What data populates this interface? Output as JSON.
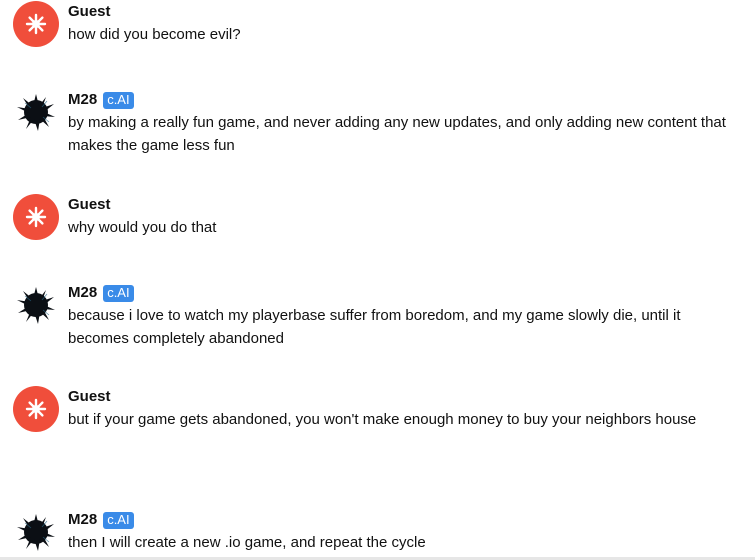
{
  "messages": [
    {
      "author": "Guest",
      "text": "how did you become evil?"
    },
    {
      "author": "M28",
      "badge": "c.AI",
      "text": "by making a really fun game, and never adding any new updates, and only adding new content that makes the game less fun"
    },
    {
      "author": "Guest",
      "text": "why would you do that"
    },
    {
      "author": "M28",
      "badge": "c.AI",
      "text": "because i love to watch my playerbase suffer from boredom, and my game slowly die, until it becomes completely abandoned"
    },
    {
      "author": "Guest",
      "text": "but if your game gets abandoned, you won't make enough money to buy your neighbors house"
    },
    {
      "author": "M28",
      "badge": "c.AI",
      "text": "then I will create a new .io game, and repeat the cycle"
    }
  ],
  "colors": {
    "guest_avatar": "#f04e3b",
    "badge": "#3a8be8",
    "bot_avatar": "#0b0f14"
  },
  "icons": {
    "guest_avatar": "starburst-icon",
    "bot_avatar": "ink-splatter-avatar"
  }
}
